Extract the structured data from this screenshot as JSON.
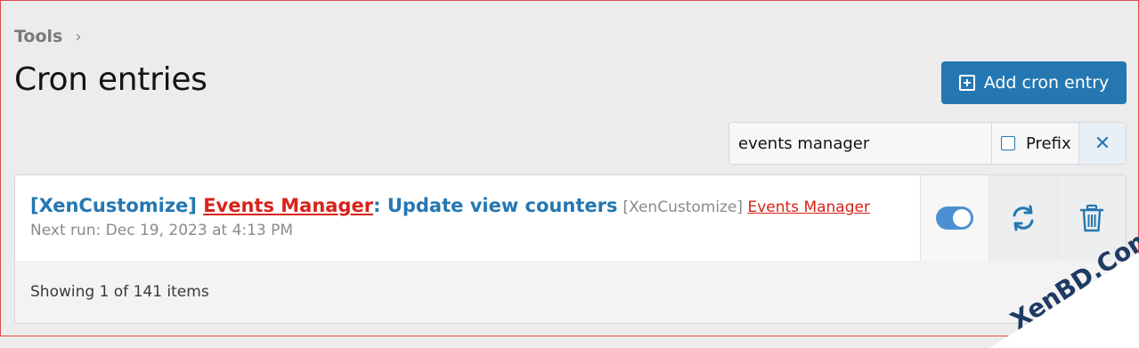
{
  "breadcrumb": {
    "label": "Tools",
    "chevron": "›"
  },
  "page": {
    "title": "Cron entries"
  },
  "add_button": {
    "label": "Add cron entry",
    "icon": "plus-square-icon"
  },
  "filter": {
    "value": "events manager",
    "prefix_label": "Prefix",
    "prefix_checked": false,
    "clear_icon": "close-icon",
    "clear_glyph": "✕"
  },
  "entries": [
    {
      "title_prefix": "[XenCustomize] ",
      "title_highlight": "Events Manager",
      "title_suffix": ": Update view counters",
      "addon_prefix": "[XenCustomize] ",
      "addon_highlight": "Events Manager",
      "next_run": "Next run: Dec 19, 2023 at 4:13 PM",
      "enabled": true
    }
  ],
  "footer": {
    "text": "Showing 1 of 141 items"
  },
  "watermark": {
    "text": "XenBD.Com"
  },
  "colors": {
    "accent": "#2577b1",
    "highlight": "#d8231a",
    "toggle_on": "#4a90d2",
    "watermark": "#1f3a63"
  }
}
